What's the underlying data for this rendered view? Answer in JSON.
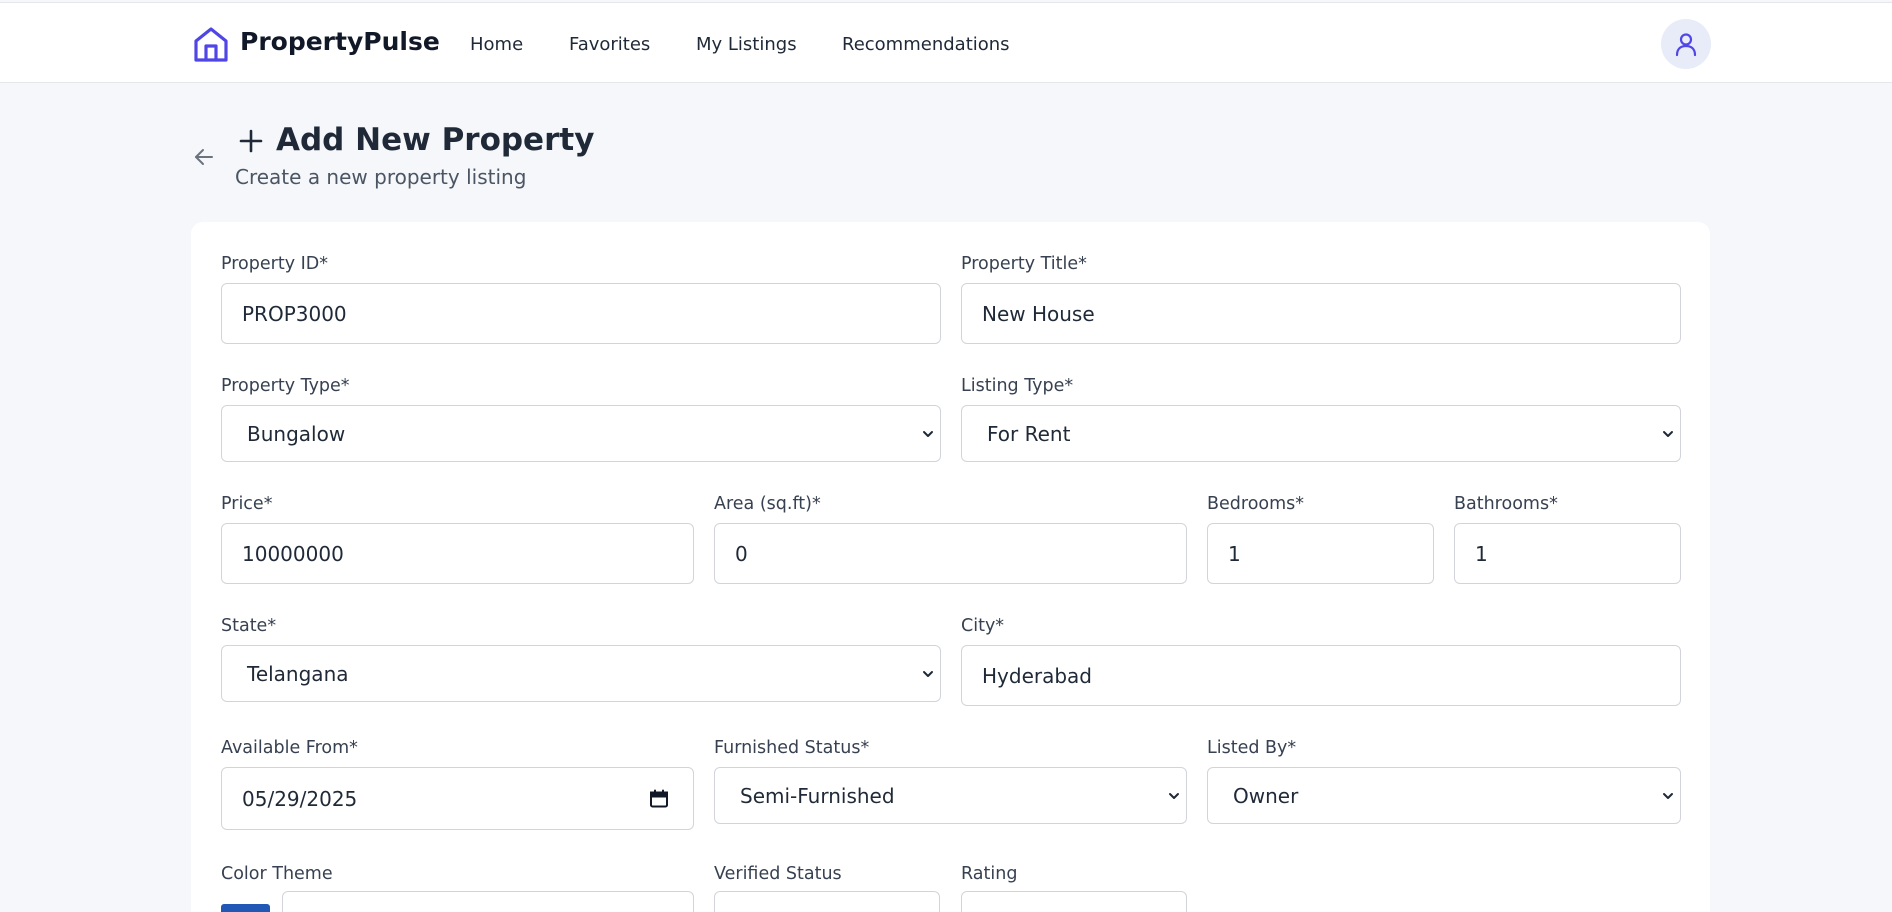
{
  "app": {
    "name": "PropertyPulse"
  },
  "nav": {
    "links": [
      {
        "label": "Home"
      },
      {
        "label": "Favorites"
      },
      {
        "label": "My Listings"
      },
      {
        "label": "Recommendations"
      }
    ]
  },
  "header": {
    "title": "Add New Property",
    "subtitle": "Create a new property listing"
  },
  "form": {
    "property_id": {
      "label": "Property ID*",
      "value": "PROP3000"
    },
    "property_title": {
      "label": "Property Title*",
      "value": "New House"
    },
    "property_type": {
      "label": "Property Type*",
      "value": "Bungalow"
    },
    "listing_type": {
      "label": "Listing Type*",
      "value": "For Rent"
    },
    "price": {
      "label": "Price*",
      "value": "10000000"
    },
    "area": {
      "label": "Area (sq.ft)*",
      "value": "0"
    },
    "bedrooms": {
      "label": "Bedrooms*",
      "value": "1"
    },
    "bathrooms": {
      "label": "Bathrooms*",
      "value": "1"
    },
    "state": {
      "label": "State*",
      "value": "Telangana"
    },
    "city": {
      "label": "City*",
      "value": "Hyderabad"
    },
    "available_from": {
      "label": "Available From*",
      "value": "05/29/2025"
    },
    "furnished_status": {
      "label": "Furnished Status*",
      "value": "Semi-Furnished"
    },
    "listed_by": {
      "label": "Listed By*",
      "value": "Owner"
    },
    "color_theme": {
      "label": "Color Theme",
      "color": "#2158b5"
    },
    "verified_status": {
      "label": "Verified Status"
    },
    "rating": {
      "label": "Rating"
    }
  },
  "icons": {
    "logo": "house-icon",
    "user": "user-icon",
    "back": "arrow-left-icon",
    "title": "plus-icon",
    "select": "chevron-down-icon",
    "date": "calendar-icon"
  },
  "colors": {
    "brand": "#4f46e5",
    "text": "#1f2937",
    "muted": "#4b5563",
    "page_bg": "#f5f7fa",
    "border": "#d1d5db"
  }
}
